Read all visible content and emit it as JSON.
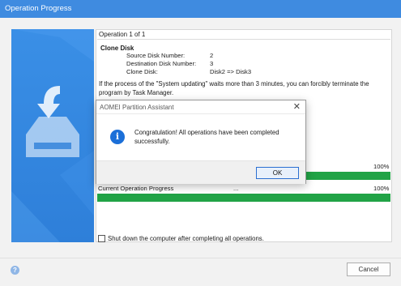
{
  "window": {
    "title": "Operation Progress"
  },
  "operation": {
    "header": "Operation 1 of 1",
    "name": "Clone Disk",
    "details": [
      {
        "label": "Source Disk Number:",
        "value": "2"
      },
      {
        "label": "Destination Disk Number:",
        "value": "3"
      },
      {
        "label": "Clone Disk:",
        "value": "Disk2 => Disk3"
      }
    ],
    "note": "If the process of the \"System updating\" waits more than 3 minutes, you can forcibly terminate the program by Task Manager."
  },
  "progress": {
    "overall": {
      "label": "",
      "percent_text": "100%",
      "value": 100
    },
    "current": {
      "label": "Current Operation Progress",
      "middle": "...",
      "percent_text": "100%",
      "value": 100
    }
  },
  "shutdown_checkbox": {
    "label": "Shut down the computer after completing all operations.",
    "checked": false
  },
  "buttons": {
    "cancel": "Cancel",
    "help": "?"
  },
  "dialog": {
    "title": "AOMEI Partition Assistant",
    "close": "✕",
    "icon": "i",
    "message": "Congratulation! All operations have been completed successfully.",
    "ok": "OK"
  },
  "colors": {
    "title_bar": "#3f8be0",
    "side_art": "#2e7fd9",
    "progress_fill": "#21a346",
    "info_icon": "#1b6fd8"
  }
}
